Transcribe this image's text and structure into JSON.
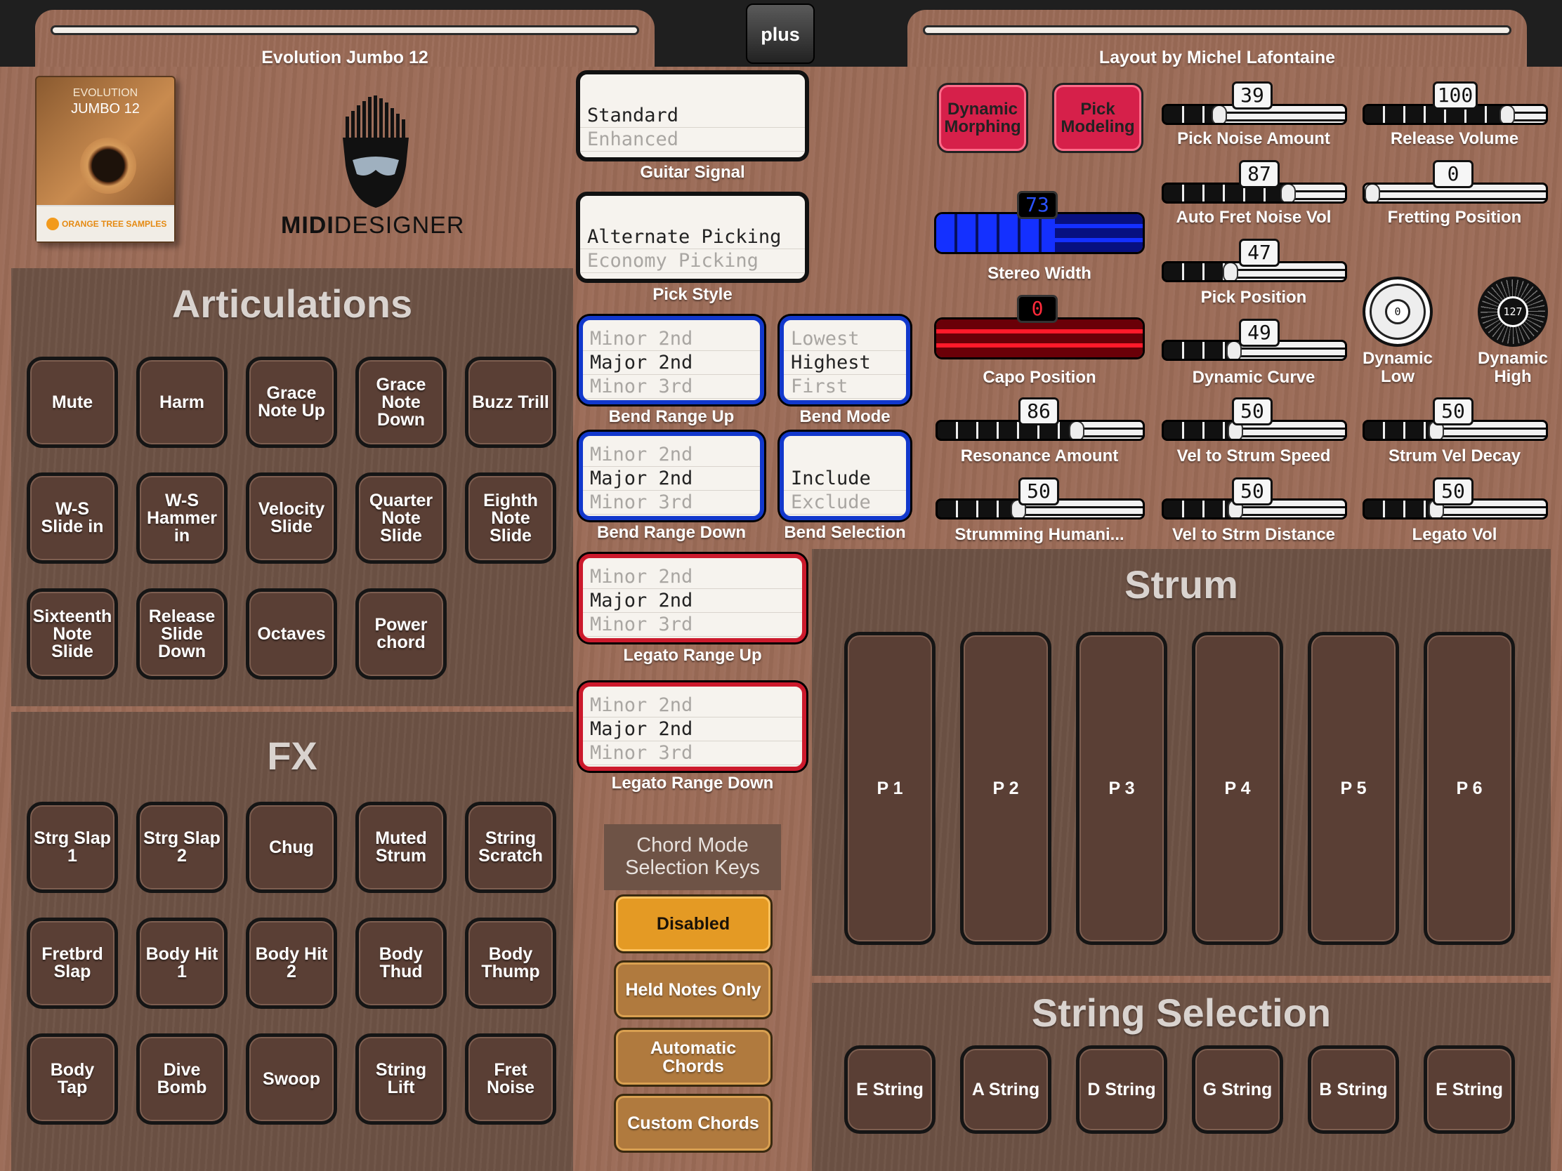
{
  "header": {
    "left_title": "Evolution Jumbo 12",
    "center_button": "plus",
    "right_title": "Layout by Michel Lafontaine"
  },
  "branding": {
    "product_box_line1": "EVOLUTION",
    "product_box_line2": "JUMBO 12",
    "vendor": "ORANGE TREE SAMPLES",
    "logo_text_bold": "MIDI",
    "logo_text_thin": "DESIGNER"
  },
  "articulations": {
    "title": "Articulations",
    "pads": [
      "Mute",
      "Harm",
      "Grace Note Up",
      "Grace Note Down",
      "Buzz Trill",
      "W-S Slide in",
      "W-S Hammer in",
      "Velocity Slide",
      "Quarter Note Slide",
      "Eighth Note Slide",
      "Sixteenth Note Slide",
      "Release Slide Down",
      "Octaves",
      "Power chord"
    ]
  },
  "fx": {
    "title": "FX",
    "pads": [
      "Strg Slap 1",
      "Strg Slap 2",
      "Chug",
      "Muted Strum",
      "String Scratch",
      "Fretbrd Slap",
      "Body Hit 1",
      "Body Hit 2",
      "Body Thud",
      "Body Thump",
      "Body Tap",
      "Dive Bomb",
      "Swoop",
      "String Lift",
      "Fret Noise"
    ]
  },
  "lists": {
    "guitar_signal": {
      "label": "Guitar Signal",
      "selected": "Standard",
      "next": "Enhanced"
    },
    "pick_style": {
      "label": "Pick Style",
      "selected": "Alternate Picking",
      "next": "Economy Picking"
    },
    "bend_range_up": {
      "label": "Bend Range Up",
      "prev": "Minor 2nd",
      "selected": "Major 2nd",
      "next": "Minor 3rd"
    },
    "bend_mode": {
      "label": "Bend Mode",
      "prev": "Lowest",
      "selected": "Highest",
      "next": "First"
    },
    "bend_range_down": {
      "label": "Bend Range Down",
      "prev": "Minor 2nd",
      "selected": "Major 2nd",
      "next": "Minor 3rd"
    },
    "bend_selection": {
      "label": "Bend Selection",
      "selected": "Include",
      "next": "Exclude"
    },
    "legato_range_up": {
      "label": "Legato Range Up",
      "prev": "Minor 2nd",
      "selected": "Major 2nd",
      "next": "Minor 3rd"
    },
    "legato_range_down": {
      "label": "Legato Range Down",
      "prev": "Minor 2nd",
      "selected": "Major 2nd",
      "next": "Minor 3rd"
    }
  },
  "chord_mode": {
    "title_line1": "Chord Mode",
    "title_line2": "Selection Keys",
    "buttons": [
      "Disabled",
      "Held Notes Only",
      "Automatic Chords",
      "Custom Chords"
    ],
    "active": "Disabled"
  },
  "toggles": {
    "dynamic_morphing": "Dynamic Morphing",
    "pick_modeling": "Pick Modeling"
  },
  "controls": {
    "pick_noise_amount": {
      "label": "Pick Noise Amount",
      "value": "39",
      "max": 127
    },
    "release_volume": {
      "label": "Release Volume",
      "value": "100",
      "max": 127
    },
    "auto_fret_noise_vol": {
      "label": "Auto Fret Noise Vol",
      "value": "87",
      "max": 127
    },
    "fretting_position": {
      "label": "Fretting Position",
      "value": "0",
      "max": 127
    },
    "stereo_width": {
      "label": "Stereo Width",
      "value": "73",
      "max": 127,
      "color": "#1430ff"
    },
    "pick_position": {
      "label": "Pick Position",
      "value": "47",
      "max": 127
    },
    "capo_position": {
      "label": "Capo Position",
      "value": "0",
      "max": 127,
      "color": "#ff1a2a"
    },
    "dynamic_curve": {
      "label": "Dynamic Curve",
      "value": "49",
      "max": 127
    },
    "dynamic_low": {
      "label": "Dynamic Low",
      "value": "0"
    },
    "dynamic_high": {
      "label": "Dynamic High",
      "value": "127"
    },
    "resonance_amount": {
      "label": "Resonance Amount",
      "value": "86",
      "max": 127
    },
    "vel_to_strum_speed": {
      "label": "Vel to Strum Speed",
      "value": "50",
      "max": 127
    },
    "strum_vel_decay": {
      "label": "Strum Vel Decay",
      "value": "50",
      "max": 127
    },
    "strumming_humani": {
      "label": "Strumming Humani...",
      "value": "50",
      "max": 127
    },
    "vel_to_strm_distance": {
      "label": "Vel to Strm Distance",
      "value": "50",
      "max": 127
    },
    "legato_vol": {
      "label": "Legato Vol",
      "value": "50",
      "max": 127
    }
  },
  "strum": {
    "title": "Strum",
    "pads": [
      "P 1",
      "P 2",
      "P 3",
      "P 4",
      "P 5",
      "P 6"
    ]
  },
  "string_selection": {
    "title": "String Selection",
    "buttons": [
      "E String",
      "A String",
      "D String",
      "G String",
      "B String",
      "E String"
    ]
  }
}
